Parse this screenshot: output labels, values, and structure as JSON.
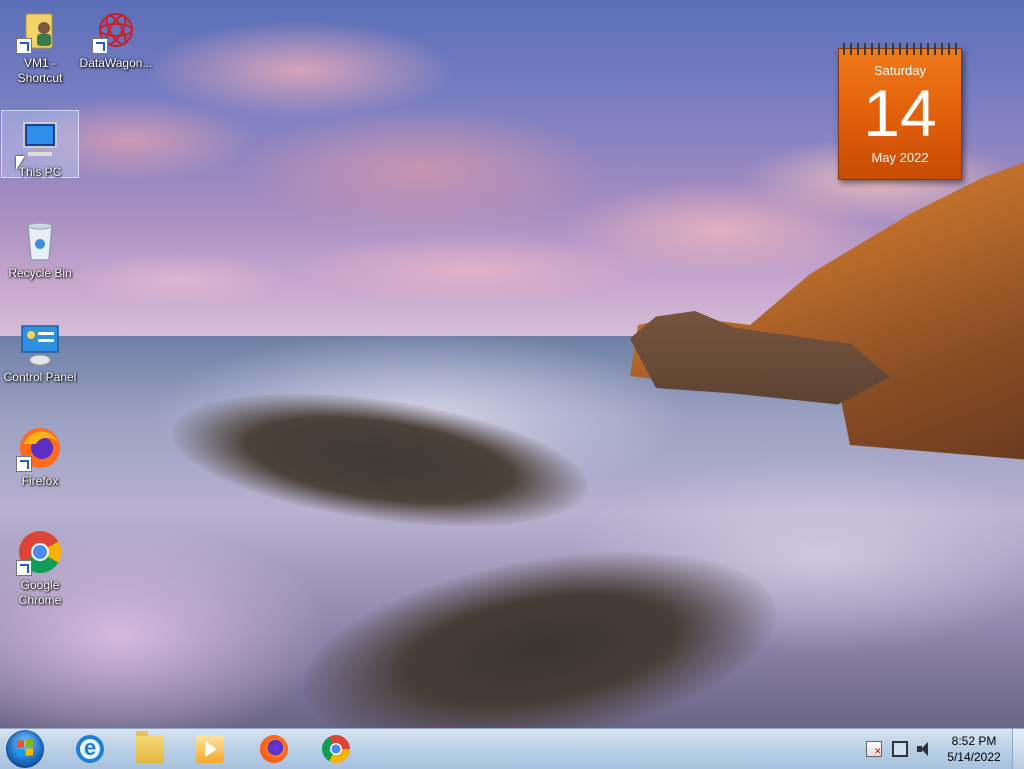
{
  "desktop": {
    "icons": [
      {
        "label": "VM1 - Shortcut",
        "icon": "user-folder-icon"
      },
      {
        "label": "DataWagon...",
        "icon": "datawagon-icon"
      },
      {
        "label": "This PC",
        "icon": "computer-icon"
      },
      {
        "label": "Recycle Bin",
        "icon": "recycle-bin-icon"
      },
      {
        "label": "Control Panel",
        "icon": "control-panel-icon"
      },
      {
        "label": "Firefox",
        "icon": "firefox-icon"
      },
      {
        "label": "Google Chrome",
        "icon": "chrome-icon"
      }
    ]
  },
  "calendar_gadget": {
    "weekday": "Saturday",
    "day": "14",
    "month_year": "May 2022",
    "color": "#e86a10"
  },
  "taskbar": {
    "pinned": [
      {
        "name": "Internet Explorer",
        "icon": "internet-explorer-icon"
      },
      {
        "name": "File Explorer",
        "icon": "folder-icon"
      },
      {
        "name": "Media Player",
        "icon": "media-player-icon"
      },
      {
        "name": "Firefox",
        "icon": "firefox-icon"
      },
      {
        "name": "Google Chrome",
        "icon": "chrome-icon"
      }
    ],
    "tray": {
      "time": "8:52 PM",
      "date": "5/14/2022"
    }
  }
}
